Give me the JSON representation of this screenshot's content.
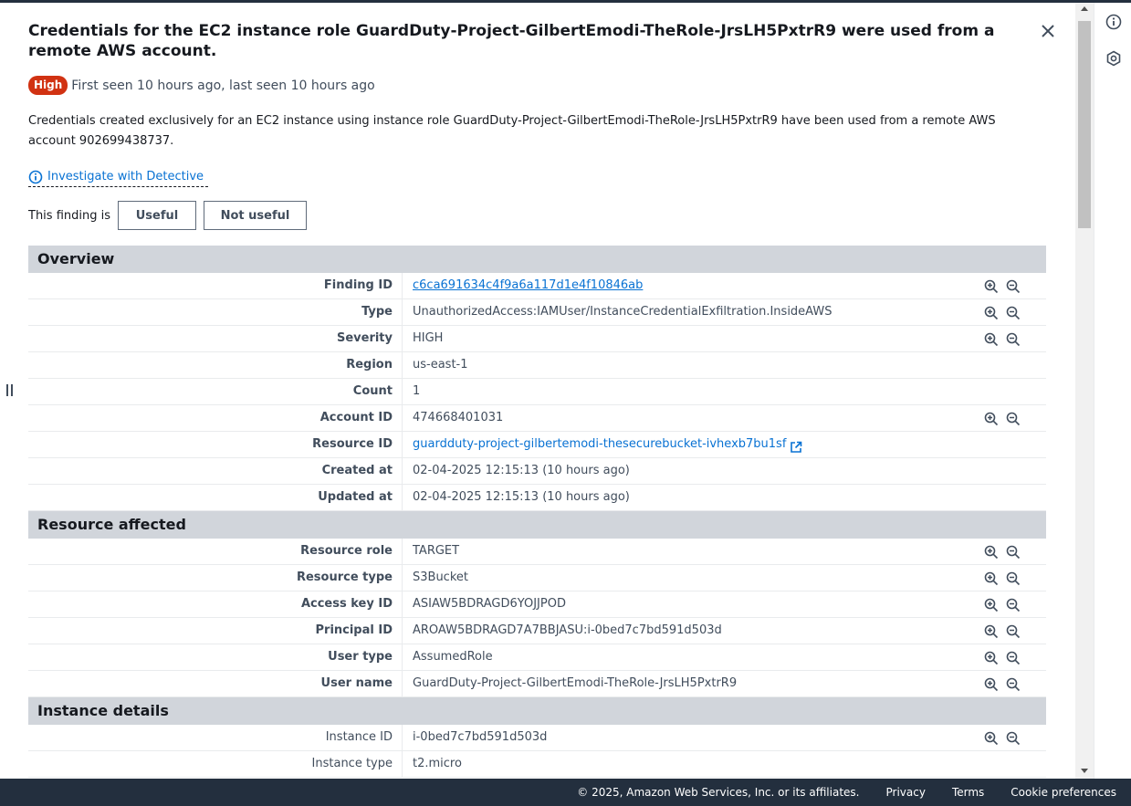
{
  "finding": {
    "title": "Credentials for the EC2 instance role GuardDuty-Project-GilbertEmodi-TheRole-JrsLH5PxtrR9 were used from a remote AWS account.",
    "severity_badge": "High",
    "seen": "First seen 10 hours ago, last seen 10 hours ago",
    "description": "Credentials created exclusively for an EC2 instance using instance role GuardDuty-Project-GilbertEmodi-TheRole-JrsLH5PxtrR9 have been used from a remote AWS account 902699438737.",
    "investigate_label": "Investigate with Detective",
    "feedback_label": "This finding is",
    "useful_label": "Useful",
    "not_useful_label": "Not useful"
  },
  "overview": {
    "heading": "Overview",
    "rows": [
      {
        "key": "Finding ID",
        "value": "c6ca691634c4f9a6a117d1e4f10846ab"
      },
      {
        "key": "Type",
        "value": "UnauthorizedAccess:IAMUser/InstanceCredentialExfiltration.InsideAWS"
      },
      {
        "key": "Severity",
        "value": "HIGH"
      },
      {
        "key": "Region",
        "value": "us-east-1"
      },
      {
        "key": "Count",
        "value": "1"
      },
      {
        "key": "Account ID",
        "value": "474668401031"
      },
      {
        "key": "Resource ID",
        "value": "guardduty-project-gilbertemodi-thesecurebucket-ivhexb7bu1sf"
      },
      {
        "key": "Created at",
        "value": "02-04-2025 12:15:13 (10 hours ago)"
      },
      {
        "key": "Updated at",
        "value": "02-04-2025 12:15:13 (10 hours ago)"
      }
    ]
  },
  "resource_affected": {
    "heading": "Resource affected",
    "rows": [
      {
        "key": "Resource role",
        "value": "TARGET"
      },
      {
        "key": "Resource type",
        "value": "S3Bucket"
      },
      {
        "key": "Access key ID",
        "value": "ASIAW5BDRAGD6YOJJPOD"
      },
      {
        "key": "Principal ID",
        "value": "AROAW5BDRAGD7A7BBJASU:i-0bed7c7bd591d503d"
      },
      {
        "key": "User type",
        "value": "AssumedRole"
      },
      {
        "key": "User name",
        "value": "GuardDuty-Project-GilbertEmodi-TheRole-JrsLH5PxtrR9"
      }
    ]
  },
  "instance_details": {
    "heading": "Instance details",
    "rows": [
      {
        "key": "Instance ID",
        "value": "i-0bed7c7bd591d503d"
      },
      {
        "key": "Instance type",
        "value": "t2.micro"
      }
    ]
  },
  "footer": {
    "copyright": "© 2025, Amazon Web Services, Inc. or its affiliates.",
    "privacy": "Privacy",
    "terms": "Terms",
    "cookies": "Cookie preferences"
  },
  "colors": {
    "severity_high": "#d13212",
    "link": "#0972d3",
    "section_header_bg": "#d1d5db",
    "footer_bg": "#232f3e"
  },
  "icons": {
    "close": "close-icon",
    "info": "info-icon",
    "zoom_in": "zoom-in-icon",
    "zoom_out": "zoom-out-icon",
    "external_link": "external-link-icon",
    "help_rail": "info-icon",
    "settings_rail": "hexagon-gear-icon"
  }
}
